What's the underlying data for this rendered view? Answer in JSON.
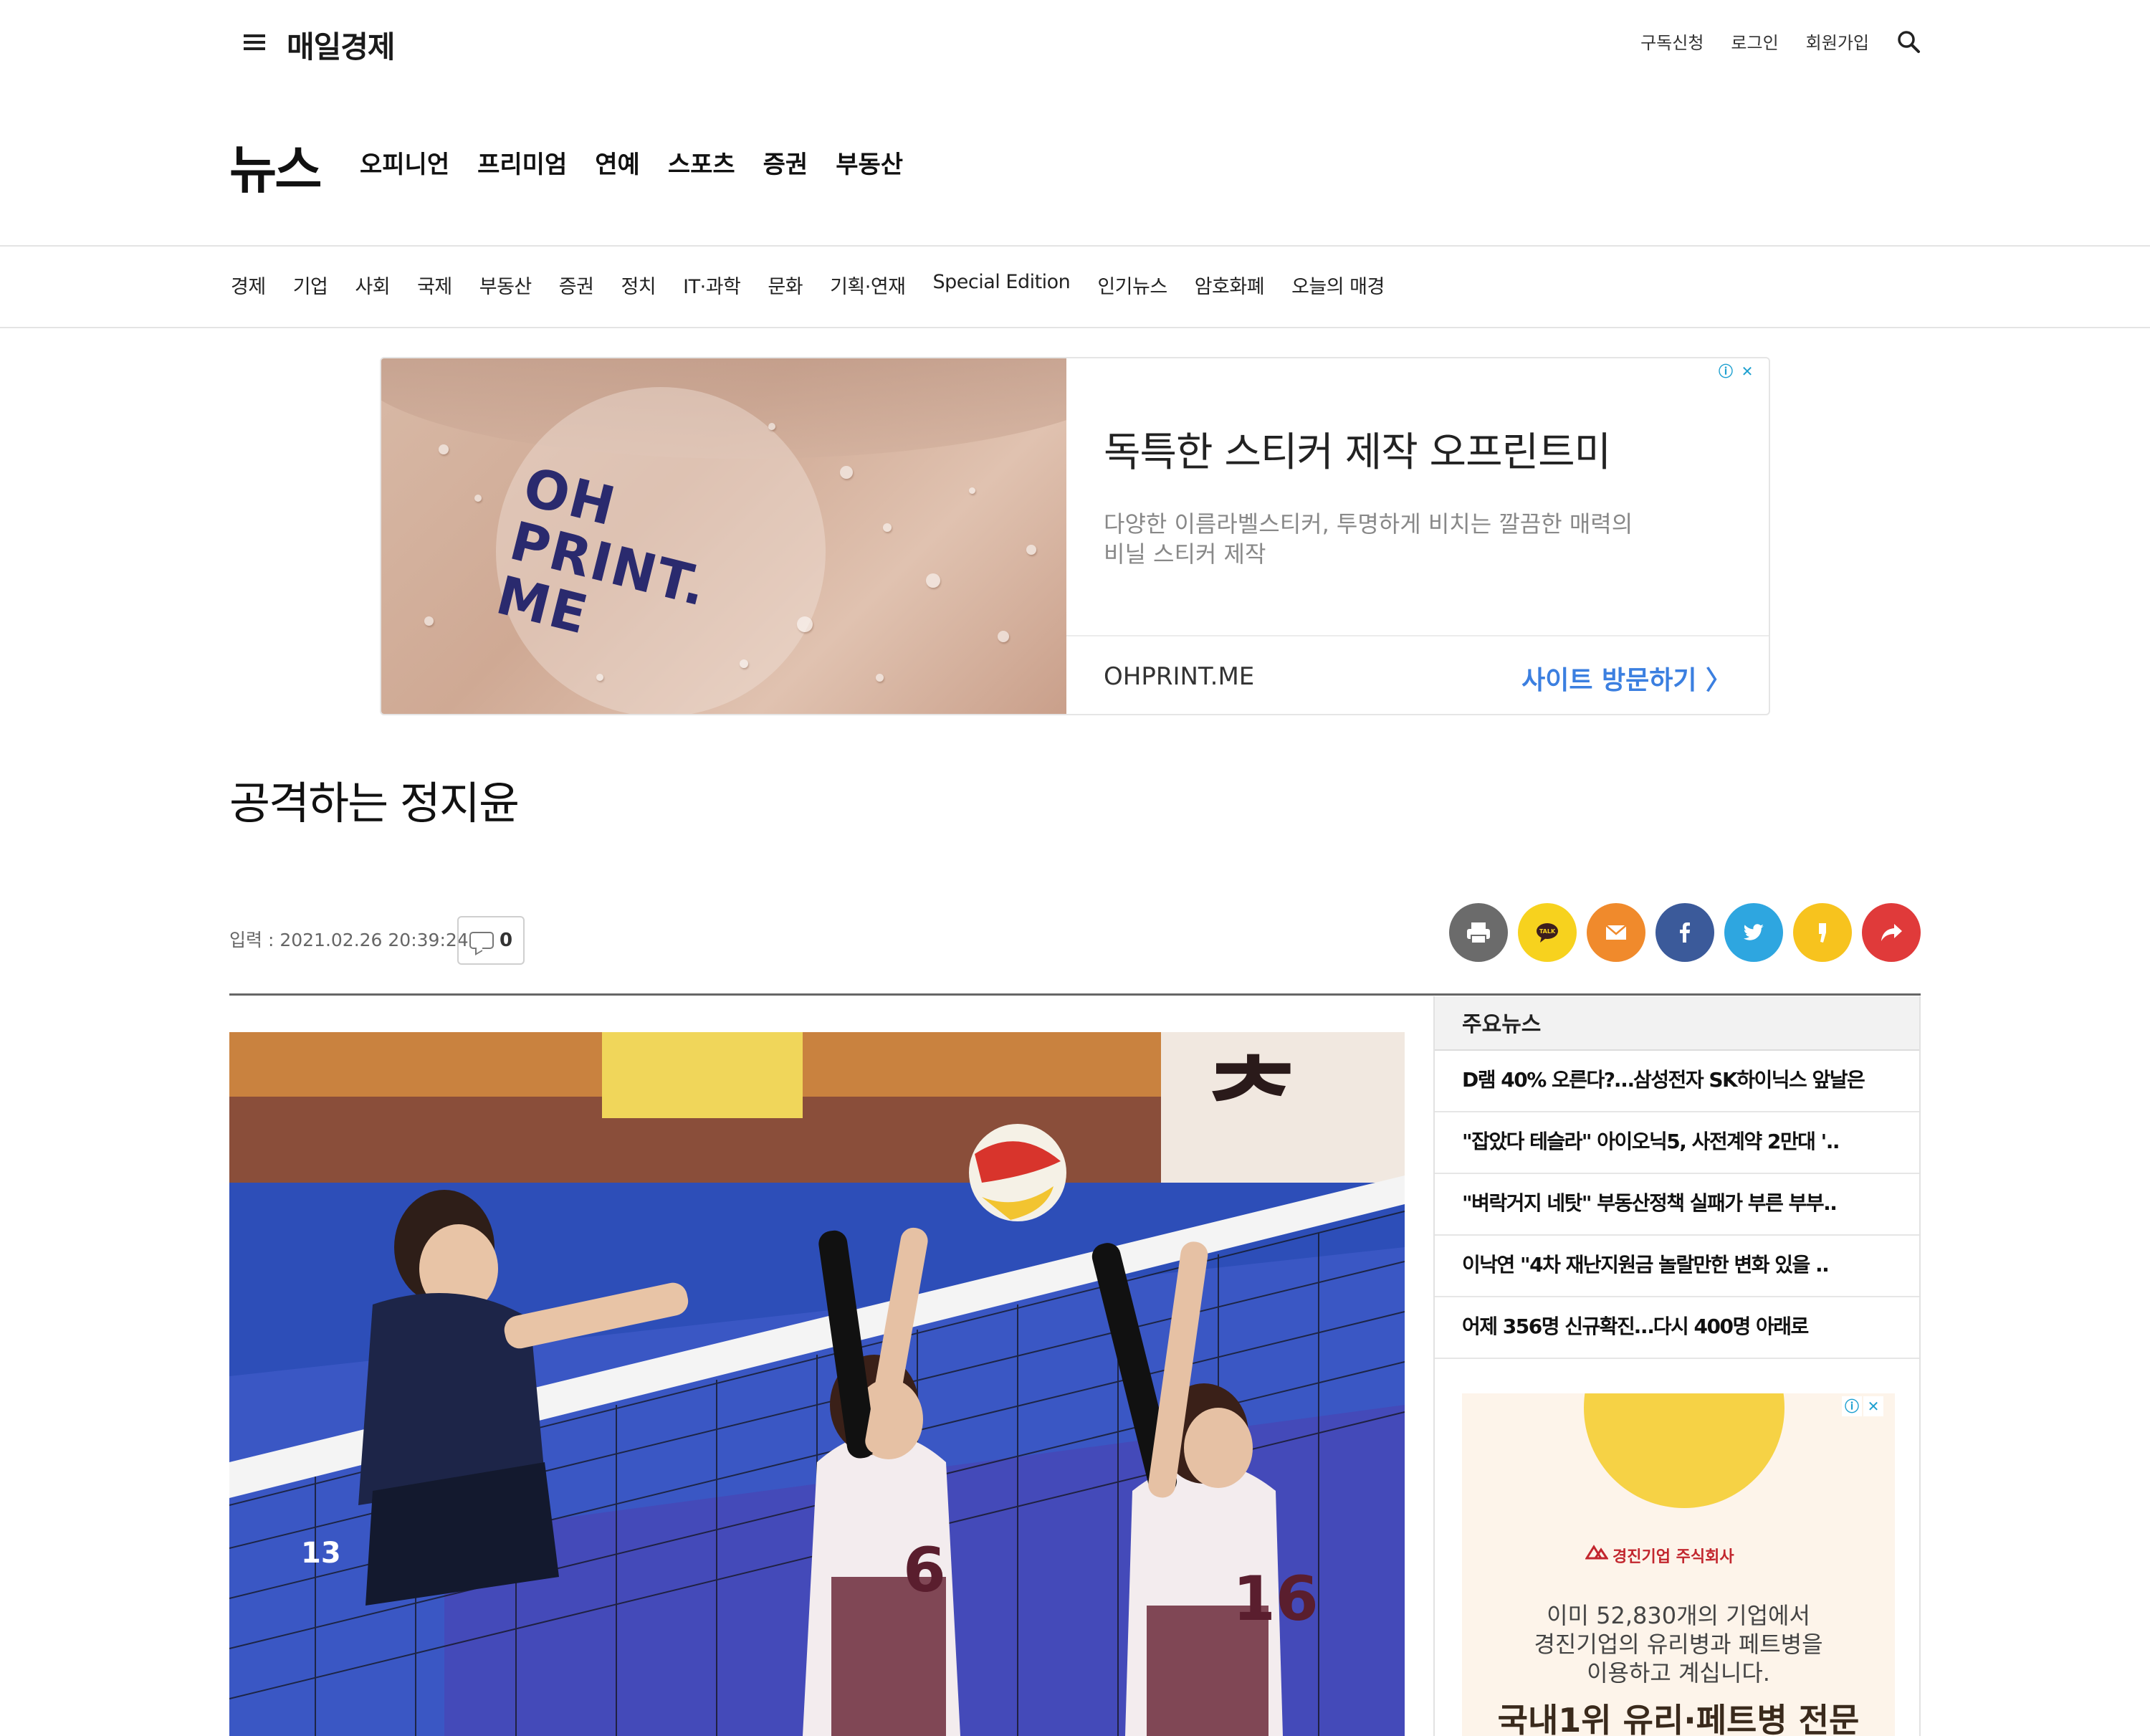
{
  "header": {
    "logo": "매일경제",
    "util_links": [
      "구독신청",
      "로그인",
      "회원가입"
    ]
  },
  "section": {
    "title": "뉴스",
    "main_nav": [
      "오피니언",
      "프리미엄",
      "연예",
      "스포츠",
      "증권",
      "부동산"
    ]
  },
  "sub_nav": [
    "경제",
    "기업",
    "사회",
    "국제",
    "부동산",
    "증권",
    "정치",
    "IT·과학",
    "문화",
    "기획·연재",
    "Special Edition",
    "인기뉴스",
    "암호화폐",
    "오늘의 매경"
  ],
  "top_ad": {
    "image_text": [
      "OH",
      "PRINT.",
      "ME"
    ],
    "title": "독특한 스티커 제작 오프린트미",
    "desc_line1": "다양한 이름라벨스티커, 투명하게 비치는 깔끔한 매력의",
    "desc_line2": "비닐 스티커 제작",
    "domain": "OHPRINT.ME",
    "cta": "사이트 방문하기 〉"
  },
  "article": {
    "headline": "공격하는 정지윤",
    "date": "입력 : 2021.02.26 20:39:24",
    "comment_count": "0"
  },
  "share": [
    {
      "name": "print-button",
      "color": "#6b6b6b"
    },
    {
      "name": "kakaotalk-button",
      "color": "#f7d21e",
      "label": "TALK"
    },
    {
      "name": "email-button",
      "color": "#f08a2c"
    },
    {
      "name": "facebook-button",
      "color": "#3b5a9a"
    },
    {
      "name": "twitter-button",
      "color": "#2ea6e0"
    },
    {
      "name": "kakaostory-button",
      "color": "#f7c31e"
    },
    {
      "name": "share-more-button",
      "color": "#e03a3a"
    }
  ],
  "sidebar": {
    "heading": "주요뉴스",
    "items": [
      "D램 40% 오른다?…삼성전자 SK하이닉스 앞날은",
      "\"잡았다 테슬라\" 아이오닉5, 사전계약 2만대 '..",
      "\"벼락거지 네탓\" 부동산정책 실패가 부른 부부..",
      "이낙연 \"4차 재난지원금 놀랄만한 변화 있을 ..",
      "어제 356명 신규확진…다시 400명 아래로"
    ],
    "ad": {
      "company": "경진기업 주식회사",
      "text_line1": "이미 52,830개의 기업에서",
      "text_line2": "경진기업의 유리병과 페트병을",
      "text_line3": "이용하고 계십니다.",
      "big": "국내1위 유리·페트병 전문"
    }
  },
  "photo": {
    "jersey_numbers": [
      "6",
      "16",
      "13"
    ]
  }
}
